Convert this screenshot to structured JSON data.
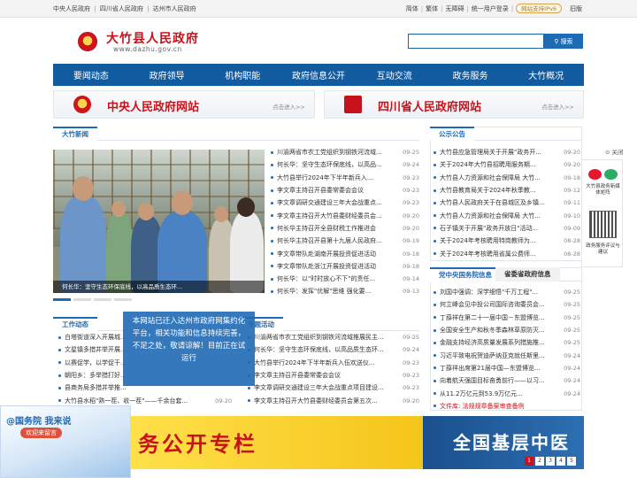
{
  "topbar": {
    "left_links": [
      "中央人民政府",
      "四川省人民政府",
      "达州市人民政府"
    ],
    "right_links": [
      "简体",
      "繁体",
      "无障碍",
      "统一用户登录"
    ],
    "ipv6": "网站支持IPv6",
    "old_version": "旧版"
  },
  "header": {
    "title": "大竹县人民政府",
    "domain": "www.dazhu.gov.cn",
    "search_placeholder": "",
    "search_label": "搜索"
  },
  "nav": [
    "要闻动态",
    "政府领导",
    "机构职能",
    "政府信息公开",
    "互动交流",
    "政务服务",
    "大竹概况"
  ],
  "banners": [
    {
      "label": "中央人民政府网站",
      "enter": "点击进入>>"
    },
    {
      "label": "四川省人民政府网站",
      "enter": "点击进入>>"
    }
  ],
  "news": {
    "tab": "大竹新闻",
    "caption": "何长华：坚守生态环保底线，以高品质生态环...",
    "items": [
      {
        "t": "川渝两省市农工党组织到钢铁河流域...",
        "d": "09-25"
      },
      {
        "t": "何长华：坚守生态环保底线，以高品...",
        "d": "09-24"
      },
      {
        "t": "大竹县举行2024年下半年新兵入...",
        "d": "09-23"
      },
      {
        "t": "李文章主持召开县委常委会会议",
        "d": "09-23"
      },
      {
        "t": "李文章调研交通建设三年大会战重点...",
        "d": "09-23"
      },
      {
        "t": "李文章主持召开大竹县委财经委员会...",
        "d": "09-20"
      },
      {
        "t": "何长华主持召开全县财税工作推进会",
        "d": "09-20"
      },
      {
        "t": "何长华主持召开县第十九届人民政府...",
        "d": "09-19"
      },
      {
        "t": "李文章带队赴湖南开展投资促进活动",
        "d": "09-18"
      },
      {
        "t": "李文章带队赴浙江开展投资促进活动",
        "d": "09-18"
      },
      {
        "t": "何长华：以\"时时放心不下\"的责任...",
        "d": "09-14"
      },
      {
        "t": "何长华：发挥\"优解\"思维 强化要...",
        "d": "09-13"
      }
    ]
  },
  "notice": {
    "tab": "公示公告",
    "items": [
      {
        "t": "大竹县应急管理局关于开展\"政务开...",
        "d": "09-20"
      },
      {
        "t": "关于2024年大竹县招聘用服务期...",
        "d": "09-20"
      },
      {
        "t": "大竹县人力资源和社会保障局 大竹...",
        "d": "09-18"
      },
      {
        "t": "大竹县教育局关于2024年秋季教...",
        "d": "09-12"
      },
      {
        "t": "大竹县人民政府关于在县城区及乡镇...",
        "d": "09-11"
      },
      {
        "t": "大竹县人力资源和社会保障局 大竹...",
        "d": "09-10"
      },
      {
        "t": "石子镇关于开展\"政务开放日\"活动...",
        "d": "09-09"
      },
      {
        "t": "关于2024年考核聘用特岗教师为...",
        "d": "08-28"
      },
      {
        "t": "关于2024年考核聘用省属公费师...",
        "d": "08-28"
      }
    ]
  },
  "state_info": {
    "tab1": "党中央国务院信息",
    "tab2": "省委省政府信息",
    "items": [
      {
        "t": "刘国中强调：深学细悟\"千万工程\"...",
        "d": "09-25"
      },
      {
        "t": "何立峰会见中投公司国际咨询委员会...",
        "d": "09-25"
      },
      {
        "t": "丁薛祥在第二十一届中国－东盟博览...",
        "d": "09-25"
      },
      {
        "t": "全国安全生产和秋冬季森林草原防灭...",
        "d": "09-25"
      },
      {
        "t": "金融支持经济高质量发展系列措施推...",
        "d": "09-25"
      },
      {
        "t": "习近平致电祝贺迪萨纳亚克就任斯里...",
        "d": "09-24"
      },
      {
        "t": "丁薛祥出席第21届中国—东盟博览...",
        "d": "09-24"
      },
      {
        "t": "向着航天强国目标奋勇前行——以习...",
        "d": "09-24"
      },
      {
        "t": "从11.2万亿元到53.9万亿元...",
        "d": "09-24"
      },
      {
        "t": "文件库: 法规规章备案审查备例",
        "d": ""
      }
    ]
  },
  "work": {
    "tab": "工作动态",
    "items": [
      {
        "t": "白塔街道深入开展城...",
        "d": ""
      },
      {
        "t": "文星镇多措并举开展...",
        "d": ""
      },
      {
        "t": "以赛促学，以学促干...",
        "d": ""
      },
      {
        "t": "朝阳乡：多举措打好...",
        "d": ""
      },
      {
        "t": "县商务局多措并举推...",
        "d": ""
      },
      {
        "t": "大竹县水稻\"熟一茬、收一茬\"——千余台套...",
        "d": "09-20"
      }
    ]
  },
  "events": {
    "tab": "专题活动",
    "items": [
      {
        "t": "川渝两省市农工党组织到钢铁河流域推展民主...",
        "d": "09-25"
      },
      {
        "t": "何长华：坚守生态环保底线，以高品质生态环...",
        "d": "09-24"
      },
      {
        "t": "大竹县举行2024年下半年新兵入伍欢送仪...",
        "d": "09-23"
      },
      {
        "t": "李文章主持召开县委常委会会议",
        "d": "09-23"
      },
      {
        "t": "李文章调研交通建设三年大会战重点项目建设...",
        "d": "09-23"
      },
      {
        "t": "李文章主持召开大竹县委财经委员会第五次...",
        "d": "09-20"
      }
    ]
  },
  "overlay_notice": {
    "text": "本网站已迁入达州市政府网集约化平台，相关功能和信息持续完善，不足之处，敬请谅解！目前正在试运行"
  },
  "float": {
    "close": "关闭",
    "weibo": "大竹县政务新媒体矩阵",
    "service": "政务服务评议与建议"
  },
  "promo": {
    "left": "务公开专栏",
    "right": "全国基层中医",
    "pages": [
      "1",
      "2",
      "3",
      "4",
      "5"
    ]
  },
  "guowuyuan": {
    "title": "@国务院 我来说",
    "sub": "欢迎来留言"
  }
}
